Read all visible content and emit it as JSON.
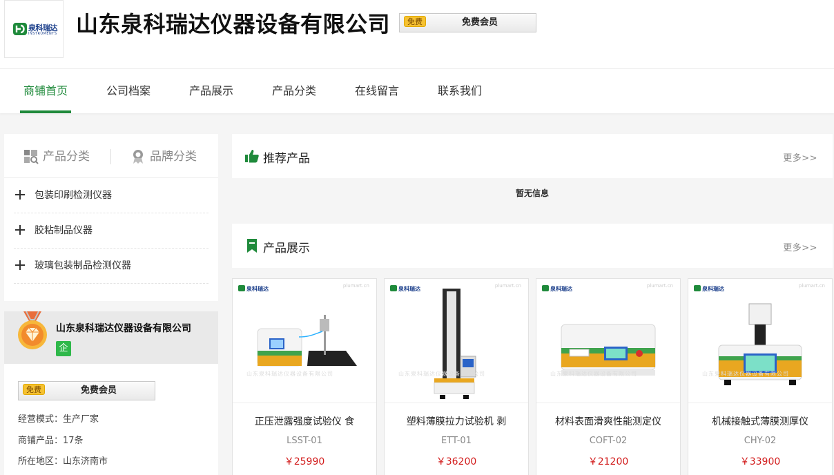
{
  "header": {
    "logo": {
      "brand": "泉科瑞达",
      "sub": "INSTRUMENTS"
    },
    "company_title": "山东泉科瑞达仪器设备有限公司",
    "member": {
      "tag": "免费",
      "label": "免费会员"
    }
  },
  "nav": {
    "items": [
      {
        "label": "商铺首页",
        "active": true
      },
      {
        "label": "公司档案",
        "active": false
      },
      {
        "label": "产品展示",
        "active": false
      },
      {
        "label": "产品分类",
        "active": false
      },
      {
        "label": "在线留言",
        "active": false
      },
      {
        "label": "联系我们",
        "active": false
      }
    ]
  },
  "sidebar": {
    "tabs": [
      {
        "label": "产品分类"
      },
      {
        "label": "品牌分类"
      }
    ],
    "categories": [
      {
        "label": "包装印刷检测仪器"
      },
      {
        "label": "胶粘制品仪器"
      },
      {
        "label": "玻璃包装制品检测仪器"
      }
    ],
    "company": {
      "name": "山东泉科瑞达仪器设备有限公司",
      "qi_badge": "企",
      "member": {
        "tag": "免费",
        "label": "免费会员"
      },
      "info": [
        {
          "label": "经营模式：",
          "value": "生产厂家"
        },
        {
          "label": "商铺产品：",
          "value": "17条"
        },
        {
          "label": "所在地区：",
          "value": "山东济南市"
        }
      ]
    }
  },
  "recommended": {
    "title": "推荐产品",
    "more": "更多>>",
    "empty": "暂无信息"
  },
  "products_section": {
    "title": "产品展示",
    "more": "更多>>",
    "items": [
      {
        "name": "正压泄露强度试验仪 食",
        "model": "LSST-01",
        "price": "￥25990",
        "logo_text": "泉科瑞达",
        "watermark": "山东泉科瑞达仪器设备有限公司",
        "site": "plumart.cn"
      },
      {
        "name": "塑料薄膜拉力试验机 剥",
        "model": "ETT-01",
        "price": "￥36200",
        "logo_text": "泉科瑞达",
        "watermark": "山东泉科瑞达仪器设备有限公司",
        "site": "plumart.cn"
      },
      {
        "name": "材料表面滑爽性能测定仪",
        "model": "COFT-02",
        "price": "￥21200",
        "logo_text": "泉科瑞达",
        "watermark": "山东泉科瑞达仪器设备有限公司",
        "site": "plumart.cn"
      },
      {
        "name": "机械接触式薄膜测厚仪",
        "model": "CHY-02",
        "price": "￥33900",
        "logo_text": "泉科瑞达",
        "watermark": "山东泉科瑞达仪器设备有限公司",
        "site": "plumart.cn"
      }
    ]
  },
  "colors": {
    "accent": "#1f8a3b",
    "price": "#d21b1b",
    "badge": "#f6c232"
  }
}
